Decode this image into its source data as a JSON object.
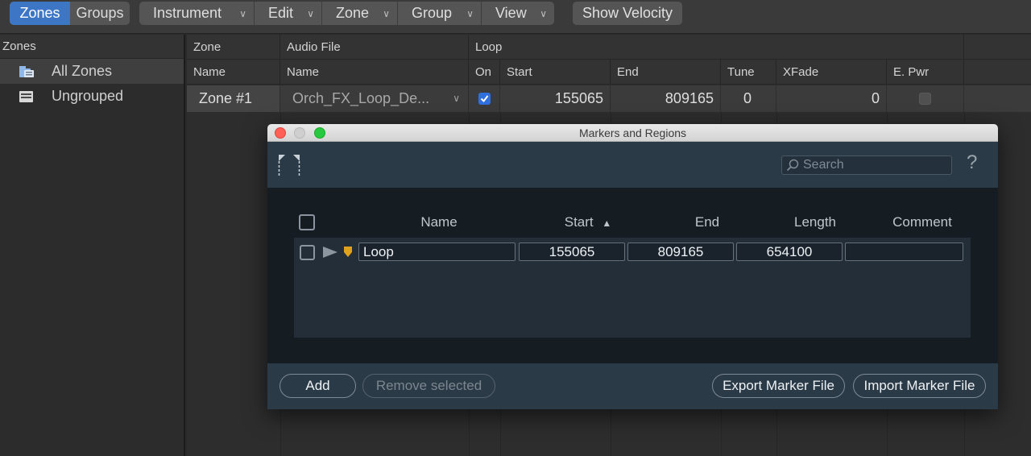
{
  "toolbar": {
    "view_tabs": [
      {
        "label": "Zones",
        "active": true
      },
      {
        "label": "Groups",
        "active": false
      }
    ],
    "menus": [
      "Instrument",
      "Edit",
      "Zone",
      "Group",
      "View"
    ],
    "show_velocity_label": "Show Velocity"
  },
  "sidebar": {
    "header": "Zones",
    "items": [
      {
        "label": "All Zones",
        "selected": true,
        "icon": "folder-list-icon"
      },
      {
        "label": "Ungrouped",
        "selected": false,
        "icon": "list-icon"
      }
    ]
  },
  "grid": {
    "group_headers": {
      "zone": "Zone",
      "audio_file": "Audio File",
      "loop": "Loop"
    },
    "columns": {
      "name": "Name",
      "file_name": "Name",
      "on": "On",
      "start": "Start",
      "end": "End",
      "tune": "Tune",
      "xfade": "XFade",
      "epwr": "E. Pwr"
    },
    "row": {
      "zone_name": "Zone #1",
      "audio_file": "Orch_FX_Loop_De...",
      "loop_on": true,
      "start": "155065",
      "end": "809165",
      "tune": "0",
      "xfade": "0",
      "equal_power": false
    }
  },
  "dialog": {
    "title": "Markers and Regions",
    "search_placeholder": "Search",
    "help_label": "?",
    "columns": {
      "name": "Name",
      "start": "Start",
      "end": "End",
      "length": "Length",
      "comment": "Comment"
    },
    "sort_indicator": "▲",
    "markers": [
      {
        "name": "Loop",
        "start": "155065",
        "end": "809165",
        "length": "654100",
        "comment": ""
      }
    ],
    "buttons": {
      "add": "Add",
      "remove": "Remove selected",
      "export": "Export Marker File",
      "import": "Import Marker File"
    },
    "colors": {
      "marker_pin": "#e0a21d",
      "close": "#fe5f57",
      "minimize": "#cfcfcf",
      "zoom": "#28c840"
    }
  }
}
